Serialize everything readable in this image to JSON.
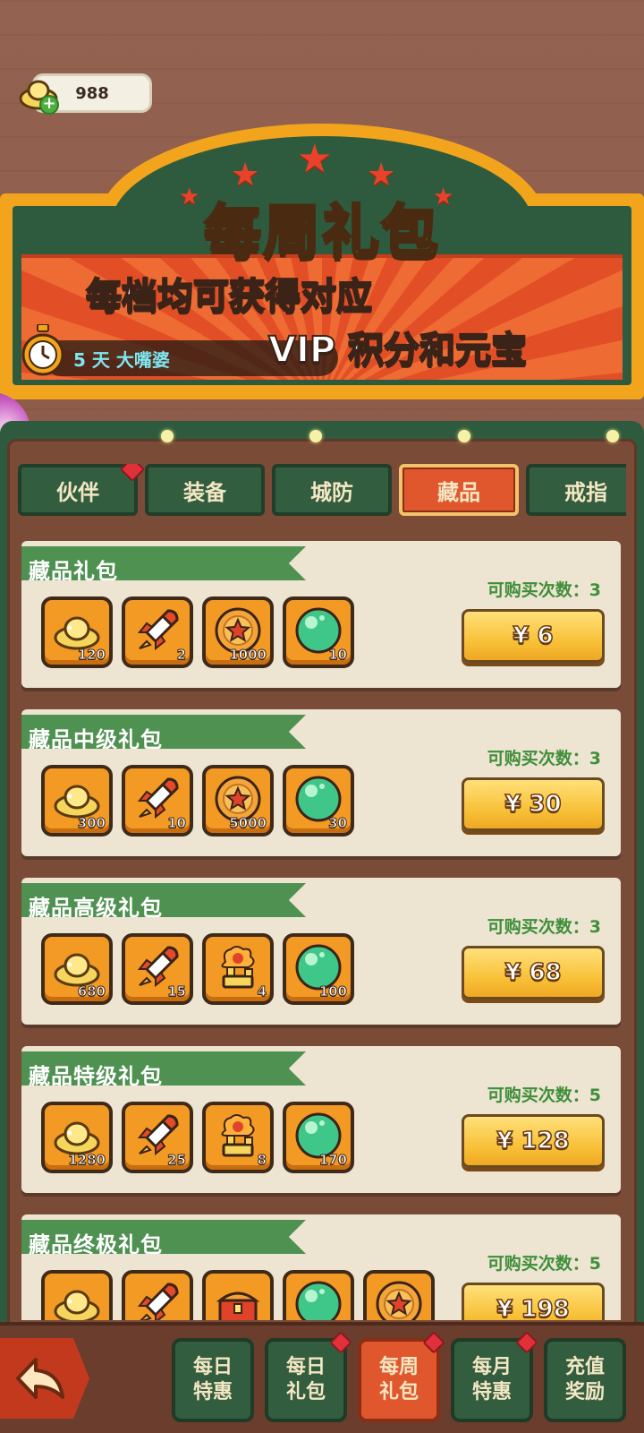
{
  "currency": {
    "amount": "988",
    "icon": "gold-ingot-icon"
  },
  "header": {
    "title": "每周礼包",
    "subtitle_line1": "每档均可获得对应",
    "subtitle_line2": "VIP 积分和元宝",
    "timer_text": "5 天 大嘴婆"
  },
  "tabs": [
    {
      "label": "伙伴",
      "active": false,
      "badge": true
    },
    {
      "label": "装备",
      "active": false,
      "badge": false
    },
    {
      "label": "城防",
      "active": false,
      "badge": false
    },
    {
      "label": "藏品",
      "active": true,
      "badge": false
    },
    {
      "label": "戒指",
      "active": false,
      "badge": false
    }
  ],
  "packs": [
    {
      "title": "藏品礼包",
      "limit_label": "可购买次数：3",
      "price": "¥ 6",
      "items": [
        {
          "icon": "gold-ingot-icon",
          "qty": "120"
        },
        {
          "icon": "rocket-icon",
          "qty": "2"
        },
        {
          "icon": "star-coin-icon",
          "qty": "1000"
        },
        {
          "icon": "green-orb-icon",
          "qty": "10"
        }
      ]
    },
    {
      "title": "藏品中级礼包",
      "limit_label": "可购买次数：3",
      "price": "¥ 30",
      "items": [
        {
          "icon": "gold-ingot-icon",
          "qty": "300"
        },
        {
          "icon": "rocket-icon",
          "qty": "10"
        },
        {
          "icon": "star-coin-icon",
          "qty": "5000"
        },
        {
          "icon": "green-orb-icon",
          "qty": "30"
        }
      ]
    },
    {
      "title": "藏品高级礼包",
      "limit_label": "可购买次数：3",
      "price": "¥ 68",
      "items": [
        {
          "icon": "gold-ingot-icon",
          "qty": "680"
        },
        {
          "icon": "rocket-icon",
          "qty": "15"
        },
        {
          "icon": "cannon-icon",
          "qty": "4"
        },
        {
          "icon": "green-orb-icon",
          "qty": "100"
        }
      ]
    },
    {
      "title": "藏品特级礼包",
      "limit_label": "可购买次数：5",
      "price": "¥ 128",
      "items": [
        {
          "icon": "gold-ingot-icon",
          "qty": "1280"
        },
        {
          "icon": "rocket-icon",
          "qty": "25"
        },
        {
          "icon": "cannon-icon",
          "qty": "8"
        },
        {
          "icon": "green-orb-icon",
          "qty": "170"
        }
      ]
    },
    {
      "title": "藏品终极礼包",
      "limit_label": "可购买次数：5",
      "price": "¥ 198",
      "items": [
        {
          "icon": "gold-ingot-icon",
          "qty": ""
        },
        {
          "icon": "rocket-icon",
          "qty": ""
        },
        {
          "icon": "treasure-chest-icon",
          "qty": ""
        },
        {
          "icon": "green-orb-icon",
          "qty": ""
        },
        {
          "icon": "star-coin-icon",
          "qty": ""
        }
      ]
    }
  ],
  "bottom_nav": [
    {
      "label": "每日\n特惠",
      "active": false,
      "badge": false
    },
    {
      "label": "每日\n礼包",
      "active": false,
      "badge": true
    },
    {
      "label": "每周\n礼包",
      "active": true,
      "badge": true
    },
    {
      "label": "每月\n特惠",
      "active": false,
      "badge": true
    },
    {
      "label": "充值\n奖励",
      "active": false,
      "badge": false
    }
  ],
  "colors": {
    "panel_green": "#2e5b3e",
    "accent_orange": "#e0572e",
    "banner_green": "#4e9150",
    "limit_green": "#3f8e3a",
    "gold": "#f8c23a"
  }
}
